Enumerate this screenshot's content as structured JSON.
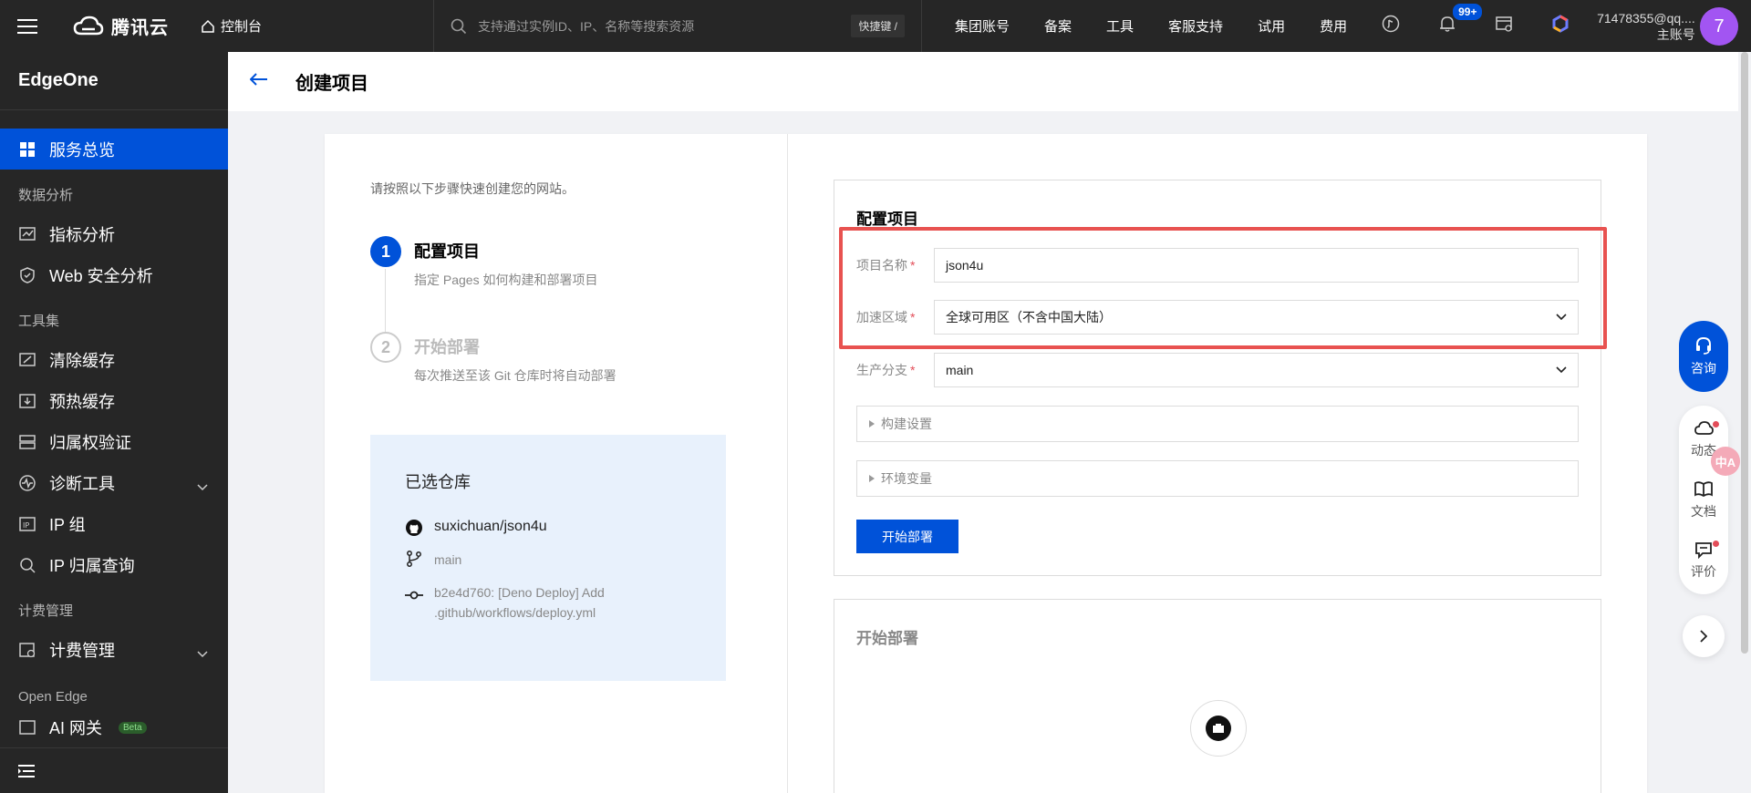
{
  "topbar": {
    "brand": "腾讯云",
    "console_label": "控制台",
    "search_placeholder": "支持通过实例ID、IP、名称等搜索资源",
    "shortcut": "快捷键 /",
    "nav": [
      "集团账号",
      "备案",
      "工具",
      "客服支持",
      "试用",
      "费用"
    ],
    "notification_count": "99+",
    "account_email": "71478355@qq....",
    "account_role": "主账号",
    "avatar_letter": "7"
  },
  "sidebar": {
    "product": "EdgeOne",
    "active_item": "服务总览",
    "group_data_analysis": "数据分析",
    "item_metrics": "指标分析",
    "item_web_security": "Web 安全分析",
    "group_tools": "工具集",
    "item_purge": "清除缓存",
    "item_prefetch": "预热缓存",
    "item_ownership": "归属权验证",
    "item_diagnose": "诊断工具",
    "item_ip_group": "IP 组",
    "item_ip_lookup": "IP 归属查询",
    "group_billing": "计费管理",
    "item_billing": "计费管理",
    "group_open_edge": "Open Edge",
    "item_ai_gateway": "AI 网关",
    "beta": "Beta"
  },
  "header": {
    "title": "创建项目"
  },
  "steps": {
    "intro": "请按照以下步骤快速创建您的网站。",
    "step1_num": "1",
    "step1_title": "配置项目",
    "step1_desc": "指定 Pages 如何构建和部署项目",
    "step2_num": "2",
    "step2_title": "开始部署",
    "step2_desc": "每次推送至该 Git 仓库时将自动部署"
  },
  "repo": {
    "title": "已选仓库",
    "name": "suxichuan/json4u",
    "branch": "main",
    "commit_line1": "b2e4d760: [Deno Deploy] Add",
    "commit_line2": ".github/workflows/deploy.yml"
  },
  "config": {
    "title": "配置项目",
    "project_name_label": "项目名称",
    "project_name_value": "json4u",
    "region_label": "加速区域",
    "region_value": "全球可用区（不含中国大陆）",
    "branch_label": "生产分支",
    "branch_value": "main",
    "build_settings": "构建设置",
    "env_vars": "环境变量",
    "deploy_button": "开始部署"
  },
  "deploy": {
    "title": "开始部署"
  },
  "float": {
    "consult": "咨询",
    "updates": "动态",
    "docs": "文档",
    "review": "评价",
    "translate": "中A"
  },
  "colors": {
    "topbar": "#262626",
    "primary": "#0052d9",
    "highlight": "#e85250",
    "required": "#e34d59"
  }
}
